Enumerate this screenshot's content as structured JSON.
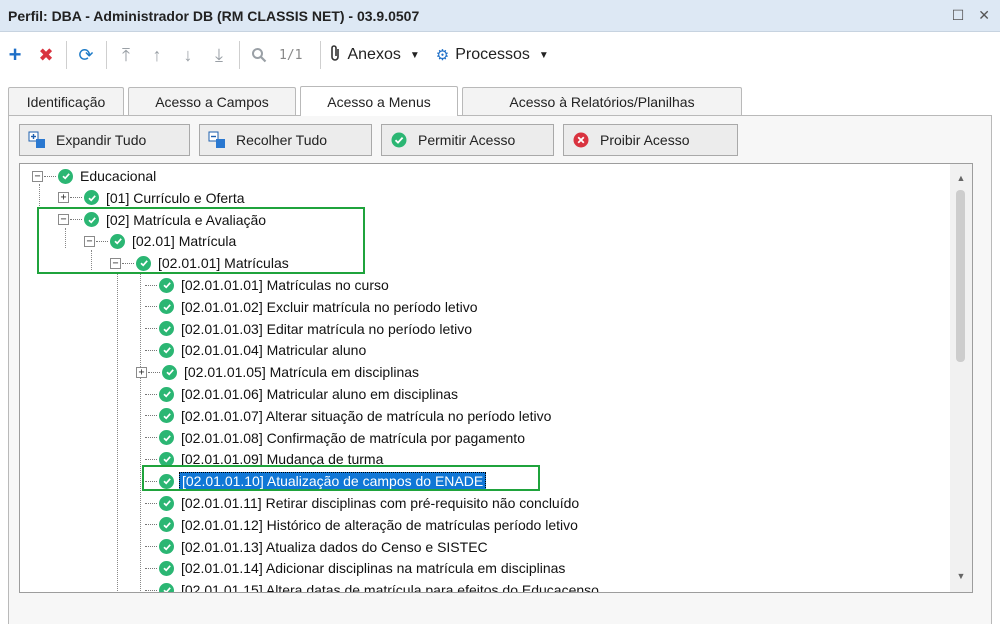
{
  "window": {
    "title": "Perfil: DBA - Administrador DB (RM CLASSIS NET) - 03.9.0507"
  },
  "toolbar": {
    "pager": "1/1",
    "menus": [
      {
        "label": "Anexos"
      },
      {
        "label": "Processos"
      }
    ]
  },
  "tabs": [
    {
      "label": "Identificação"
    },
    {
      "label": "Acesso a Campos"
    },
    {
      "label": "Acesso a Menus"
    },
    {
      "label": "Acesso à Relatórios/Planilhas"
    }
  ],
  "actions": [
    {
      "label": "Expandir Tudo"
    },
    {
      "label": "Recolher Tudo"
    },
    {
      "label": "Permitir Acesso"
    },
    {
      "label": "Proibir Acesso"
    }
  ],
  "tree": {
    "nodes": [
      {
        "label": "Educacional"
      },
      {
        "label": "[01] Currículo e Oferta"
      },
      {
        "label": "[02] Matrícula e Avaliação"
      },
      {
        "label": "[02.01] Matrícula"
      },
      {
        "label": "[02.01.01] Matrículas"
      },
      {
        "label": "[02.01.01.01] Matrículas no curso"
      },
      {
        "label": "[02.01.01.02] Excluir matrícula no período letivo"
      },
      {
        "label": "[02.01.01.03] Editar matrícula no período letivo"
      },
      {
        "label": "[02.01.01.04] Matricular aluno"
      },
      {
        "label": "[02.01.01.05] Matrícula em disciplinas"
      },
      {
        "label": "[02.01.01.06] Matricular aluno em disciplinas"
      },
      {
        "label": "[02.01.01.07] Alterar situação de matrícula no período letivo"
      },
      {
        "label": "[02.01.01.08] Confirmação de matrícula por pagamento"
      },
      {
        "label": "[02.01.01.09] Mudança de turma"
      },
      {
        "label": "[02.01.01.10] Atualização de campos do ENADE"
      },
      {
        "label": "[02.01.01.11] Retirar disciplinas com pré-requisito não concluído"
      },
      {
        "label": "[02.01.01.12] Histórico de alteração de matrículas período letivo"
      },
      {
        "label": "[02.01.01.13] Atualiza dados do Censo e SISTEC"
      },
      {
        "label": "[02.01.01.14] Adicionar disciplinas na matrícula em disciplinas"
      },
      {
        "label": "[02.01.01.15] Altera datas de matrícula para efeitos do Educacenso"
      }
    ]
  },
  "colors": {
    "accent": "#1177d6",
    "check": "#2bb673",
    "highlight": "#1fa33c",
    "deny": "#d9333f"
  }
}
